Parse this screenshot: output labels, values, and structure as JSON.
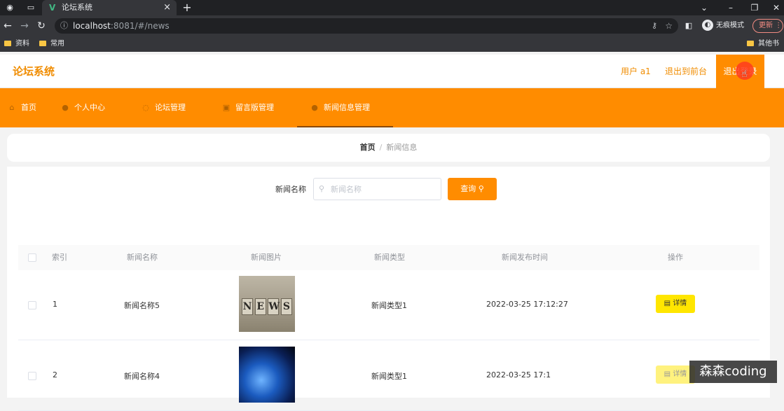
{
  "browser": {
    "tab_title": "论坛系统",
    "url_host": "localhost",
    "url_rest": ":8081/#/news",
    "incognito_label": "无痕模式",
    "update_label": "更新",
    "bookmarks": [
      "资料",
      "常用"
    ],
    "other_bookmarks": "其他书签"
  },
  "header": {
    "app_title": "论坛系统",
    "user_label": "用户 a1",
    "back_to_front": "退出到前台",
    "logout": "退出登录"
  },
  "nav": {
    "items": [
      {
        "label": "首页",
        "icon": "home-icon"
      },
      {
        "label": "个人中心",
        "icon": "user-icon"
      },
      {
        "label": "论坛管理",
        "icon": "forum-icon"
      },
      {
        "label": "留言版管理",
        "icon": "message-icon"
      },
      {
        "label": "新闻信息管理",
        "icon": "news-icon",
        "active": true
      }
    ]
  },
  "breadcrumb": {
    "home": "首页",
    "separator": "/",
    "current": "新闻信息"
  },
  "search": {
    "label": "新闻名称",
    "placeholder": "新闻名称",
    "value": "",
    "button": "查询"
  },
  "table": {
    "headers": [
      "索引",
      "新闻名称",
      "新闻图片",
      "新闻类型",
      "新闻发布时间",
      "操作"
    ],
    "rows": [
      {
        "index": "1",
        "name": "新闻名称5",
        "image": "news-blocks-image",
        "type": "新闻类型1",
        "time": "2022-03-25 17:12:27",
        "action": "详情"
      },
      {
        "index": "2",
        "name": "新闻名称4",
        "image": "globe-image",
        "type": "新闻类型1",
        "time": "2022-03-25 17:1",
        "action": "详情"
      }
    ]
  },
  "watermark": "森森coding",
  "colors": {
    "accent": "#ff8c00",
    "detail_button": "#ffe600"
  }
}
